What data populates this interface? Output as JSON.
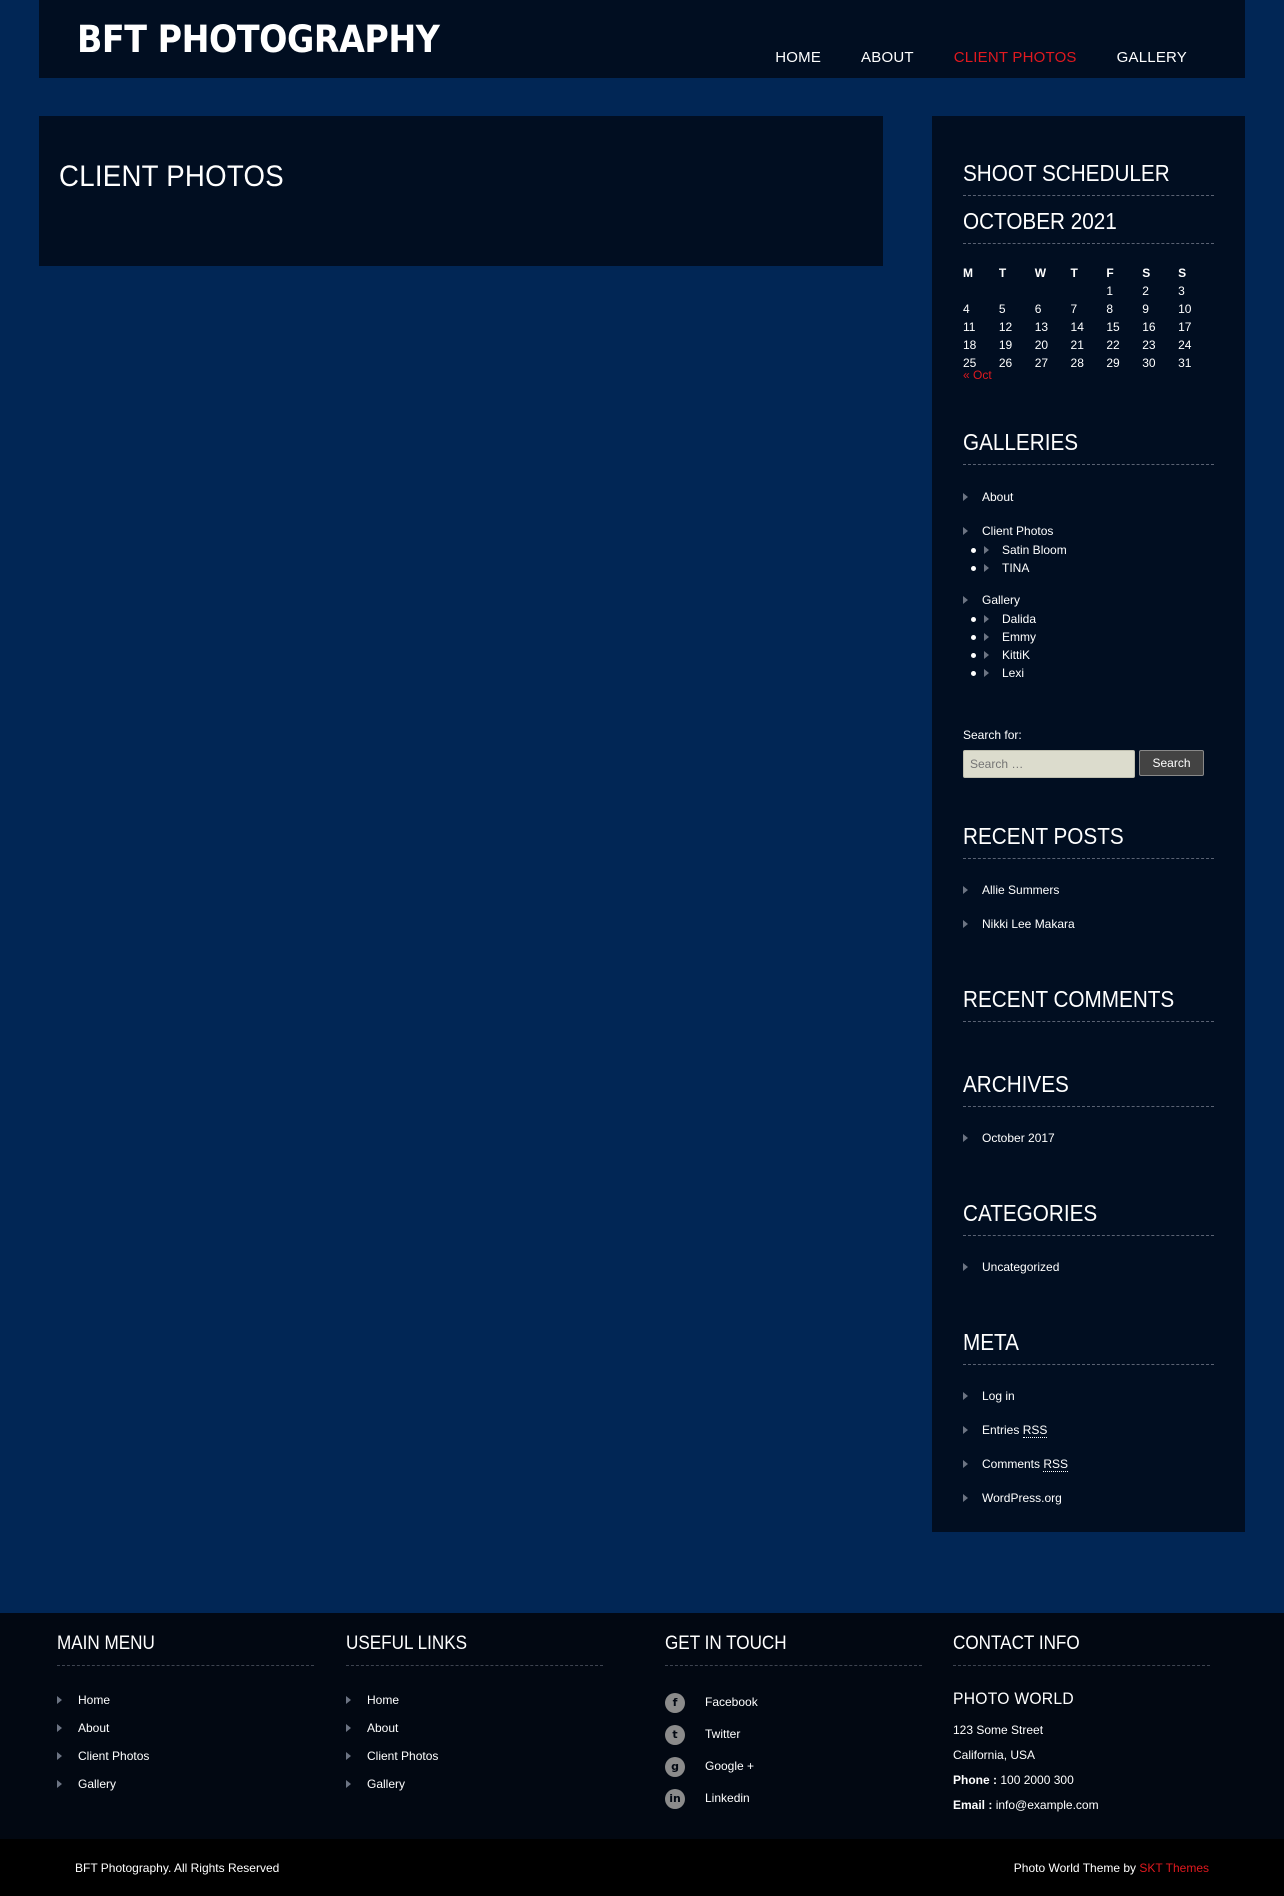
{
  "header": {
    "logo": "BFT PHOTOGRAPHY",
    "nav": [
      "HOME",
      "ABOUT",
      "CLIENT PHOTOS",
      "GALLERY"
    ],
    "active_nav": "CLIENT PHOTOS"
  },
  "main": {
    "title": "CLIENT PHOTOS"
  },
  "sidebar": {
    "shoot_scheduler": {
      "title": "SHOOT SCHEDULER",
      "month": "OCTOBER 2021",
      "weekdays": [
        "M",
        "T",
        "W",
        "T",
        "F",
        "S",
        "S"
      ],
      "weeks": [
        [
          "",
          "",
          "",
          "",
          "1",
          "2",
          "3"
        ],
        [
          "4",
          "5",
          "6",
          "7",
          "8",
          "9",
          "10"
        ],
        [
          "11",
          "12",
          "13",
          "14",
          "15",
          "16",
          "17"
        ],
        [
          "18",
          "19",
          "20",
          "21",
          "22",
          "23",
          "24"
        ],
        [
          "25",
          "26",
          "27",
          "28",
          "29",
          "30",
          "31"
        ]
      ],
      "prev_link": "« Oct"
    },
    "galleries": {
      "title": "GALLERIES",
      "about": "About",
      "client_photos": "Client Photos",
      "client_children": [
        "Satin Bloom",
        "TINA"
      ],
      "gallery": "Gallery",
      "gallery_children": [
        "Dalida",
        "Emmy",
        "KittiK",
        "Lexi"
      ]
    },
    "search": {
      "label": "Search for:",
      "placeholder": "Search …",
      "button": "Search"
    },
    "recent_posts": {
      "title": "RECENT POSTS",
      "items": [
        "Allie Summers",
        "Nikki Lee Makara"
      ]
    },
    "recent_comments": {
      "title": "RECENT COMMENTS"
    },
    "archives": {
      "title": "ARCHIVES",
      "items": [
        "October 2017"
      ]
    },
    "categories": {
      "title": "CATEGORIES",
      "items": [
        "Uncategorized"
      ]
    },
    "meta": {
      "title": "META",
      "login": "Log in",
      "entries": "Entries",
      "comments": "Comments",
      "rss": "RSS",
      "wordpress": "WordPress.org"
    }
  },
  "footer": {
    "main_menu": {
      "title": "MAIN MENU",
      "items": [
        "Home",
        "About",
        "Client Photos",
        "Gallery"
      ]
    },
    "useful_links": {
      "title": "USEFUL LINKS",
      "items": [
        "Home",
        "About",
        "Client Photos",
        "Gallery"
      ]
    },
    "get_in_touch": {
      "title": "GET IN TOUCH",
      "items": [
        {
          "icon": "facebook-icon",
          "label": "Facebook"
        },
        {
          "icon": "twitter-icon",
          "label": "Twitter"
        },
        {
          "icon": "google-plus-icon",
          "label": "Google +"
        },
        {
          "icon": "linkedin-icon",
          "label": "Linkedin"
        }
      ]
    },
    "contact_info": {
      "title": "CONTACT INFO",
      "org": "PHOTO WORLD",
      "street": "123 Some Street",
      "city": "California, USA",
      "phone_label": "Phone :",
      "phone": "100 2000 300",
      "email_label": "Email :",
      "email": "info@example.com"
    }
  },
  "bottom": {
    "copyright": "BFT Photography. All Rights Reserved",
    "credit_prefix": "Photo World Theme by",
    "credit_link": "SKT Themes"
  },
  "colors": {
    "accent": "#e0191f",
    "page_bg": "#012655",
    "panel_bg": "#010e21",
    "footer_bg": "#020812"
  }
}
